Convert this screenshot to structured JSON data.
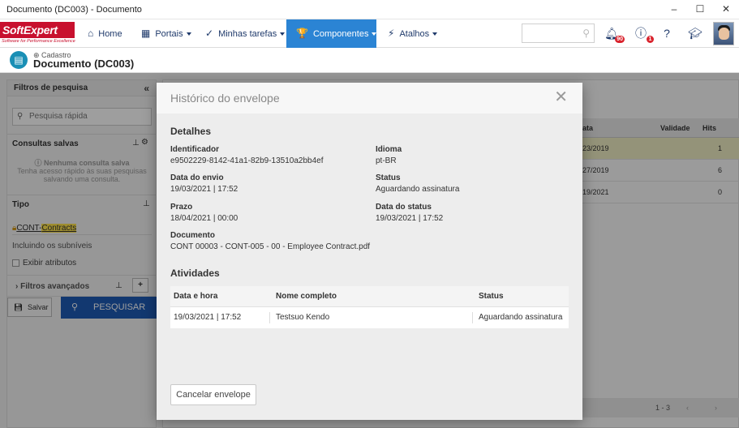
{
  "window": {
    "title": "Documento (DC003) - Documento",
    "minimize": "‒",
    "maximize": "☐",
    "close": "✕"
  },
  "logo": {
    "text": "SoftExpert",
    "tagline": "Software for Performance Excellence"
  },
  "nav": {
    "home": "Home",
    "portais": "Portais",
    "tarefas": "Minhas tarefas",
    "componentes": "Componentes",
    "atalhos": "Atalhos",
    "notifications_badge": "90",
    "alerts_badge": "1"
  },
  "icons": {
    "home": "home-icon",
    "portais": "grid-icon",
    "tarefas": "check-icon",
    "componentes": "trophy-icon",
    "atalhos": "bolt-icon"
  },
  "header": {
    "breadcrumb": "Cadastro",
    "title": "Documento (DC003)"
  },
  "sidebar": {
    "title": "Filtros de pesquisa",
    "quick_search_placeholder": "Pesquisa rápida",
    "consultas_title": "Consultas salvas",
    "consultas_empty_title": "Nenhuma consulta salva",
    "consultas_empty_text": "Tenha acesso rápido às suas pesquisas salvando uma consulta.",
    "tipo_title": "Tipo",
    "tipo_link_prefix": "CONT-",
    "tipo_link_highlight": "Contracts",
    "subniveis": "Incluindo os subníveis",
    "exibir_atributos": "Exibir atributos",
    "filtros_avancados": "Filtros avançados",
    "salvar": "Salvar",
    "pesquisar": "PESQUISAR"
  },
  "grid": {
    "headers": [
      "ata",
      "Validade",
      "Hits"
    ],
    "rows": [
      {
        "date": "23/2019",
        "hits": "1"
      },
      {
        "date": "27/2019",
        "hits": "6"
      },
      {
        "date": "19/2021",
        "hits": "0"
      }
    ],
    "pager": "1 - 3",
    "highlight_color": "#efedc4"
  },
  "modal": {
    "title": "Histórico do envelope",
    "details_title": "Detalhes",
    "fields": {
      "identificador_label": "Identificador",
      "identificador": "e9502229-8142-41a1-82b9-13510a2bb4ef",
      "idioma_label": "Idioma",
      "idioma": "pt-BR",
      "data_envio_label": "Data do envio",
      "data_envio": "19/03/2021 | 17:52",
      "status_label": "Status",
      "status": "Aguardando assinatura",
      "prazo_label": "Prazo",
      "prazo": "18/04/2021 | 00:00",
      "data_status_label": "Data do status",
      "data_status": "19/03/2021 | 17:52",
      "documento_label": "Documento",
      "documento": "CONT 00003 - CONT-005 - 00 - Employee Contract.pdf"
    },
    "activities_title": "Atividades",
    "activities": {
      "headers": [
        "Data e hora",
        "Nome completo",
        "Status"
      ],
      "rows": [
        {
          "data": "19/03/2021 | 17:52",
          "nome": "Testsuo Kendo",
          "status": "Aguardando assinatura"
        }
      ]
    },
    "cancel_button": "Cancelar envelope"
  },
  "colors": {
    "accent": "#2b84d4",
    "brand": "#c8102e",
    "primary_button": "#1e5bb5",
    "nav_text": "#1f3a6b"
  }
}
